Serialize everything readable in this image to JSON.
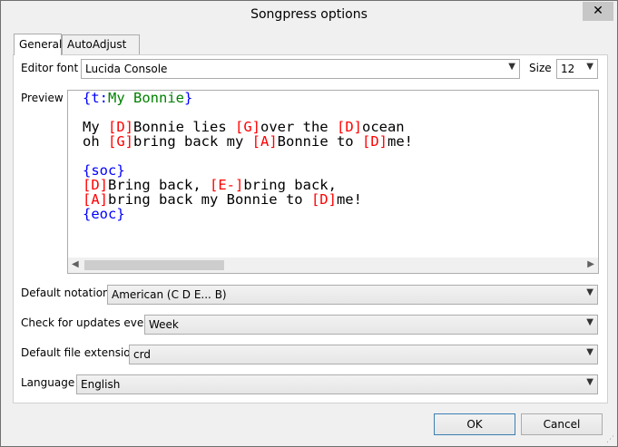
{
  "window": {
    "title": "Songpress options",
    "close_glyph": "✕"
  },
  "tabs": [
    {
      "label": "General",
      "active": true
    },
    {
      "label": "AutoAdjust",
      "active": false
    }
  ],
  "editor_font": {
    "label": "Editor font",
    "value": "Lucida Console"
  },
  "size": {
    "label": "Size",
    "value": "12"
  },
  "preview": {
    "label": "Preview",
    "lines": [
      [
        {
          "t": "{t:",
          "c": "blue"
        },
        {
          "t": "My Bonnie",
          "c": "green"
        },
        {
          "t": "}",
          "c": "blue"
        }
      ],
      [],
      [
        {
          "t": "My ",
          "c": "black"
        },
        {
          "t": "[D]",
          "c": "red"
        },
        {
          "t": "Bonnie lies ",
          "c": "black"
        },
        {
          "t": "[G]",
          "c": "red"
        },
        {
          "t": "over the ",
          "c": "black"
        },
        {
          "t": "[D]",
          "c": "red"
        },
        {
          "t": "ocean",
          "c": "black"
        }
      ],
      [
        {
          "t": "oh ",
          "c": "black"
        },
        {
          "t": "[G]",
          "c": "red"
        },
        {
          "t": "bring back my ",
          "c": "black"
        },
        {
          "t": "[A]",
          "c": "red"
        },
        {
          "t": "Bonnie to ",
          "c": "black"
        },
        {
          "t": "[D]",
          "c": "red"
        },
        {
          "t": "me!",
          "c": "black"
        }
      ],
      [],
      [
        {
          "t": "{soc}",
          "c": "blue"
        }
      ],
      [
        {
          "t": "[D]",
          "c": "red"
        },
        {
          "t": "Bring back, ",
          "c": "black"
        },
        {
          "t": "[E-]",
          "c": "red"
        },
        {
          "t": "bring back,",
          "c": "black"
        }
      ],
      [
        {
          "t": "[A]",
          "c": "red"
        },
        {
          "t": "bring back my Bonnie to ",
          "c": "black"
        },
        {
          "t": "[D]",
          "c": "red"
        },
        {
          "t": "me!",
          "c": "black"
        }
      ],
      [
        {
          "t": "{eoc}",
          "c": "blue"
        }
      ]
    ]
  },
  "default_notation": {
    "label": "Default notation",
    "value": "American (C D E... B)"
  },
  "check_updates": {
    "label": "Check for updates every",
    "value": "Week"
  },
  "default_extension": {
    "label": "Default file extension",
    "value": "crd"
  },
  "language": {
    "label": "Language",
    "value": "English"
  },
  "buttons": {
    "ok": "OK",
    "cancel": "Cancel"
  },
  "icons": {
    "dropdown": "chevron-down-icon",
    "close": "close-icon",
    "scroll_left": "arrow-left-icon",
    "scroll_right": "arrow-right-icon"
  },
  "colors": {
    "directive": "#0000ff",
    "title_text": "#008000",
    "chord": "#ff0000"
  }
}
